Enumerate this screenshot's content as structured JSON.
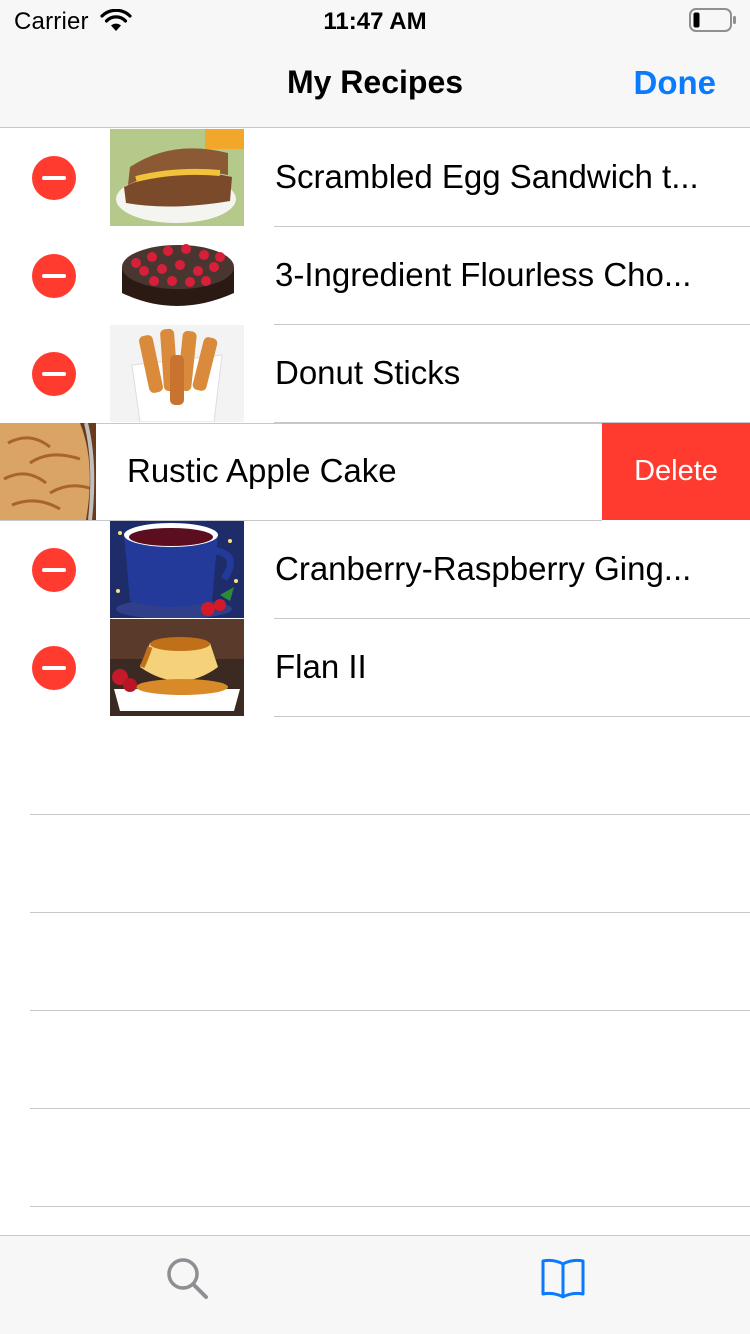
{
  "status_bar": {
    "carrier": "Carrier",
    "time": "11:47 AM"
  },
  "nav": {
    "title": "My Recipes",
    "done_label": "Done"
  },
  "recipes": [
    {
      "title": "Scrambled Egg Sandwich t...",
      "image": "sandwich"
    },
    {
      "title": "3-Ingredient Flourless Cho...",
      "image": "chocolate-cake"
    },
    {
      "title": "Donut Sticks",
      "image": "donut-sticks"
    },
    {
      "title": "Rustic Apple Cake",
      "image": "apple-cake",
      "swiped": true
    },
    {
      "title": "Cranberry-Raspberry Ging...",
      "image": "tea-cup"
    },
    {
      "title": "Flan II",
      "image": "flan"
    }
  ],
  "row_actions": {
    "delete_label": "Delete"
  },
  "tab_bar": {
    "items": [
      {
        "icon": "search-icon"
      },
      {
        "icon": "book-icon",
        "selected": true
      }
    ]
  },
  "colors": {
    "accent": "#0a7aff",
    "destructive": "#ff3b30",
    "separator": "#c8c7cc",
    "bar_background": "#f7f7f7",
    "tab_inactive": "#8e8e93"
  }
}
